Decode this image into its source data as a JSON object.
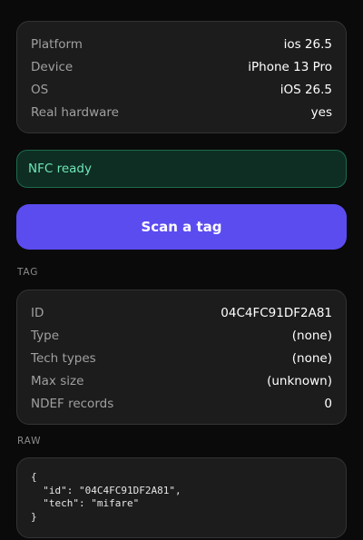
{
  "device": {
    "rows": [
      {
        "label": "Platform",
        "value": "ios 26.5"
      },
      {
        "label": "Device",
        "value": "iPhone 13 Pro"
      },
      {
        "label": "OS",
        "value": "iOS 26.5"
      },
      {
        "label": "Real hardware",
        "value": "yes"
      }
    ]
  },
  "status": {
    "text": "NFC ready",
    "color": "#6ee7b7",
    "background": "#0e2e24"
  },
  "scan_button": {
    "label": "Scan a tag",
    "color": "#5b4cf0"
  },
  "tag": {
    "section_label": "TAG",
    "rows": [
      {
        "label": "ID",
        "value": "04C4FC91DF2A81"
      },
      {
        "label": "Type",
        "value": "(none)"
      },
      {
        "label": "Tech types",
        "value": "(none)"
      },
      {
        "label": "Max size",
        "value": "(unknown)"
      },
      {
        "label": "NDEF records",
        "value": "0"
      }
    ]
  },
  "raw": {
    "section_label": "RAW",
    "json_text": "{\n  \"id\": \"04C4FC91DF2A81\",\n  \"tech\": \"mifare\"\n}"
  }
}
